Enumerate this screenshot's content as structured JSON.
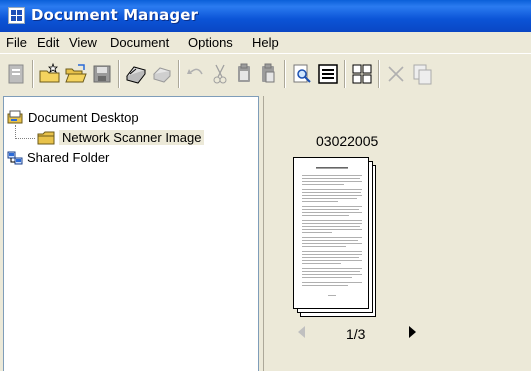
{
  "window": {
    "title": "Document Manager"
  },
  "menu": [
    "File",
    "Edit",
    "View",
    "Document",
    "Options",
    "Help"
  ],
  "toolbar_icons": [
    "properties-icon",
    "new-folder-icon",
    "open-folder-icon",
    "save-icon",
    "scan-icon",
    "print-icon",
    "undo-icon",
    "cut-icon",
    "copy-icon",
    "paste-icon",
    "find-icon",
    "list-view-icon",
    "thumbnail-view-icon",
    "delete-icon",
    "duplicate-icon"
  ],
  "tree": {
    "root_label": "Document Desktop",
    "child_label": "Network Scanner Image",
    "shared_label": "Shared Folder"
  },
  "document": {
    "name": "03022005",
    "page_indicator": "1/3"
  },
  "colors": {
    "titlebar": "#0a5fd8",
    "chrome": "#ece9d8",
    "tree_border": "#7f9db9"
  }
}
